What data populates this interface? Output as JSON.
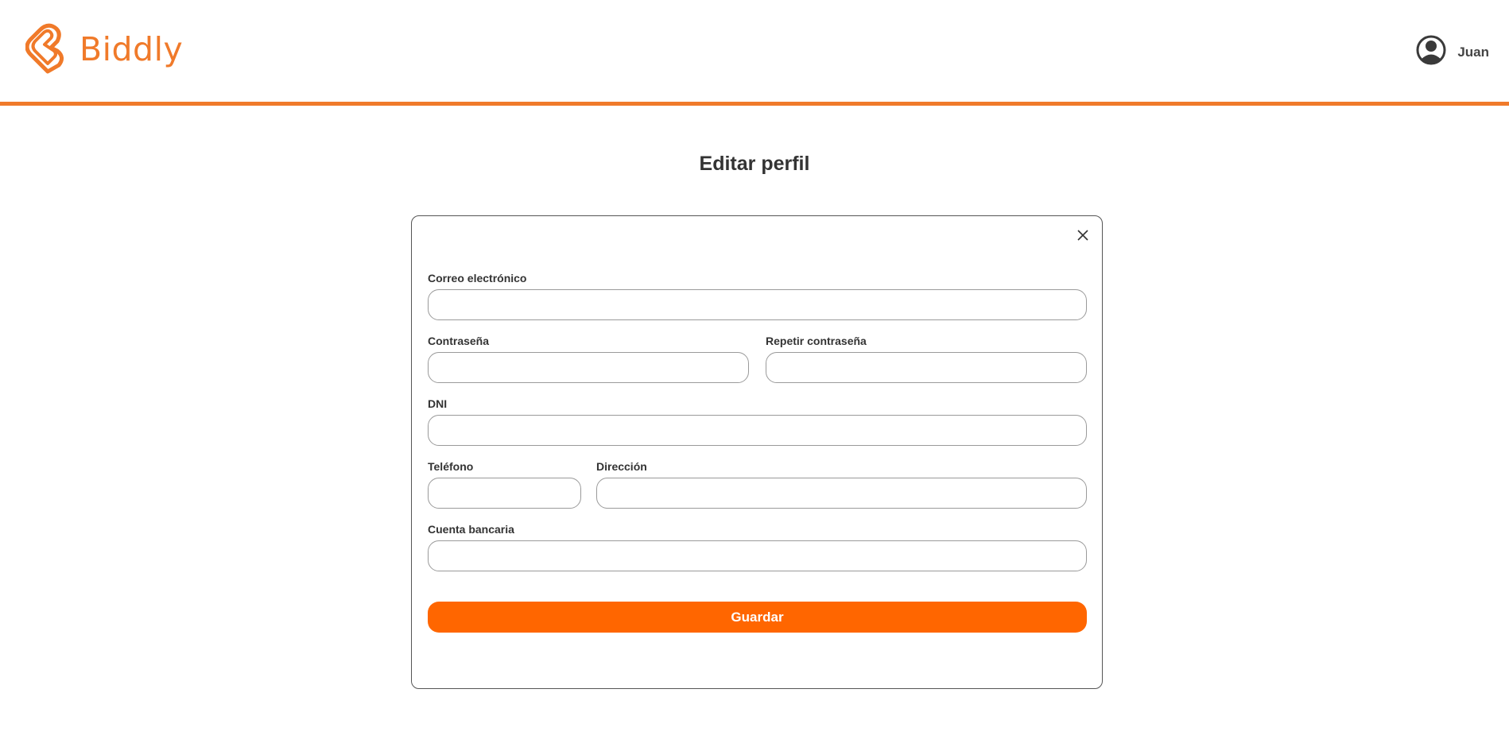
{
  "header": {
    "logo_text": "Biddly",
    "user_name": "Juan",
    "accent_color": "#f07a2a"
  },
  "page": {
    "title": "Editar perfil"
  },
  "form": {
    "email": {
      "label": "Correo electrónico",
      "value": "",
      "placeholder": ""
    },
    "password": {
      "label": "Contraseña",
      "value": "",
      "placeholder": ""
    },
    "repeat_password": {
      "label": "Repetir contraseña",
      "value": "",
      "placeholder": ""
    },
    "dni": {
      "label": "DNI",
      "value": "",
      "placeholder": ""
    },
    "phone": {
      "label": "Teléfono",
      "value": "",
      "placeholder": ""
    },
    "address": {
      "label": "Dirección",
      "value": "",
      "placeholder": ""
    },
    "bank_account": {
      "label": "Cuenta bancaria",
      "value": "",
      "placeholder": ""
    },
    "save_label": "Guardar",
    "save_color": "#ff6600"
  },
  "icons": {
    "logo": "heart-b-logo-icon",
    "user": "user-circle-icon",
    "close": "close-icon"
  }
}
